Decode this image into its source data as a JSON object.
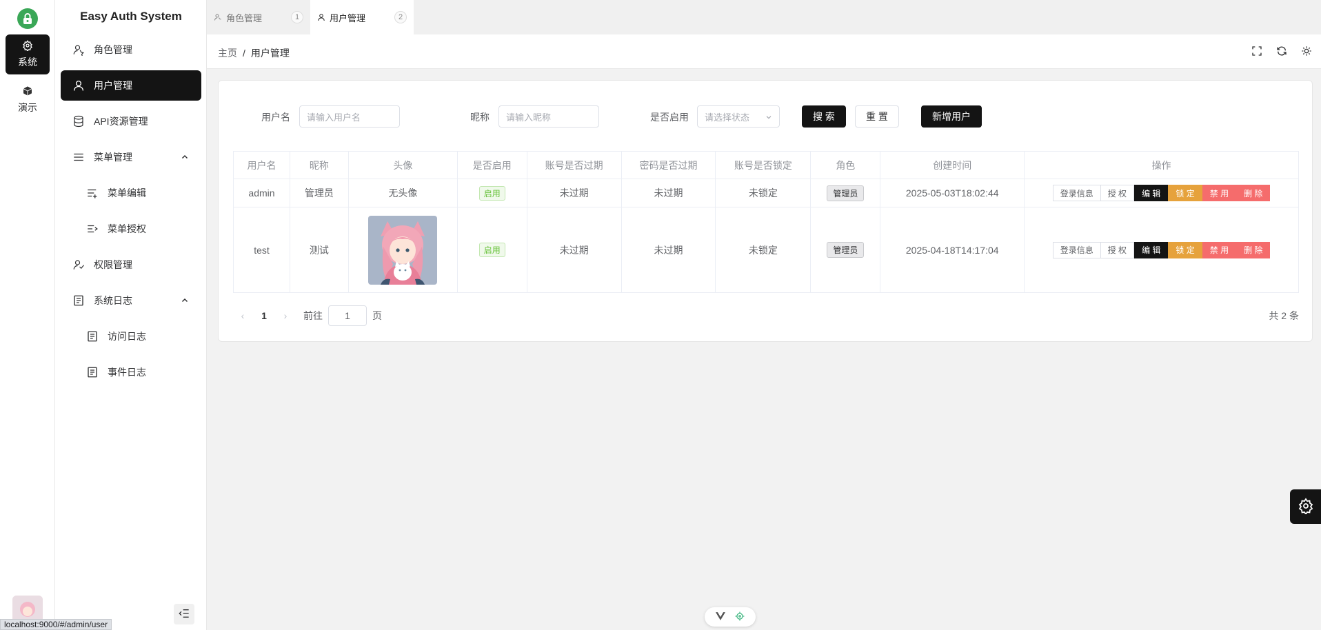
{
  "app": {
    "title": "Easy Auth System"
  },
  "rail": {
    "items": [
      {
        "label": "系统",
        "icon": "gear-icon",
        "active": true
      },
      {
        "label": "演示",
        "icon": "cube-icon",
        "active": false
      }
    ]
  },
  "sidebar": {
    "items": [
      {
        "label": "角色管理",
        "icon": "role-icon"
      },
      {
        "label": "用户管理",
        "icon": "user-icon",
        "active": true
      },
      {
        "label": "API资源管理",
        "icon": "database-icon"
      },
      {
        "label": "菜单管理",
        "icon": "menu-icon",
        "expanded": true
      },
      {
        "label": "菜单编辑",
        "icon": "menu-edit-icon"
      },
      {
        "label": "菜单授权",
        "icon": "menu-auth-icon"
      },
      {
        "label": "权限管理",
        "icon": "permission-icon"
      },
      {
        "label": "系统日志",
        "icon": "log-icon",
        "expanded": true
      },
      {
        "label": "访问日志",
        "icon": "document-icon"
      },
      {
        "label": "事件日志",
        "icon": "document-icon"
      }
    ]
  },
  "tabs": [
    {
      "label": "角色管理",
      "num": "1"
    },
    {
      "label": "用户管理",
      "num": "2",
      "active": true
    }
  ],
  "breadcrumb": {
    "home": "主页",
    "separator": "/",
    "current": "用户管理"
  },
  "search": {
    "username_label": "用户名",
    "username_placeholder": "请输入用户名",
    "nickname_label": "昵称",
    "nickname_placeholder": "请输入昵称",
    "enabled_label": "是否启用",
    "enabled_placeholder": "请选择状态",
    "search_button": "搜 索",
    "reset_button": "重 置",
    "add_button": "新增用户"
  },
  "table": {
    "headers": [
      "用户名",
      "昵称",
      "头像",
      "是否启用",
      "账号是否过期",
      "密码是否过期",
      "账号是否锁定",
      "角色",
      "创建时间",
      "操作"
    ],
    "rows": [
      {
        "username": "admin",
        "nickname": "管理员",
        "avatar": "无头像",
        "enabled": "启用",
        "account_expired": "未过期",
        "password_expired": "未过期",
        "locked": "未锁定",
        "role": "管理员",
        "created": "2025-05-03T18:02:44"
      },
      {
        "username": "test",
        "nickname": "测试",
        "avatar": "",
        "enabled": "启用",
        "account_expired": "未过期",
        "password_expired": "未过期",
        "locked": "未锁定",
        "role": "管理员",
        "created": "2025-04-18T14:17:04"
      }
    ],
    "actions": {
      "login_info": "登录信息",
      "authorize": "授 权",
      "edit": "编 辑",
      "lock": "锁 定",
      "disable": "禁 用",
      "delete": "删 除"
    }
  },
  "pagination": {
    "prev": "‹",
    "current": "1",
    "next": "›",
    "goto_label": "前往",
    "goto_value": "1",
    "page_suffix": "页",
    "total": "共 2 条"
  },
  "status_url": "localhost:9000/#/admin/user",
  "colors": {
    "primary_dark": "#141414",
    "success": "#67c23a",
    "warning": "#e6a23c",
    "danger": "#f56c6c",
    "logo": "#3aa757"
  }
}
